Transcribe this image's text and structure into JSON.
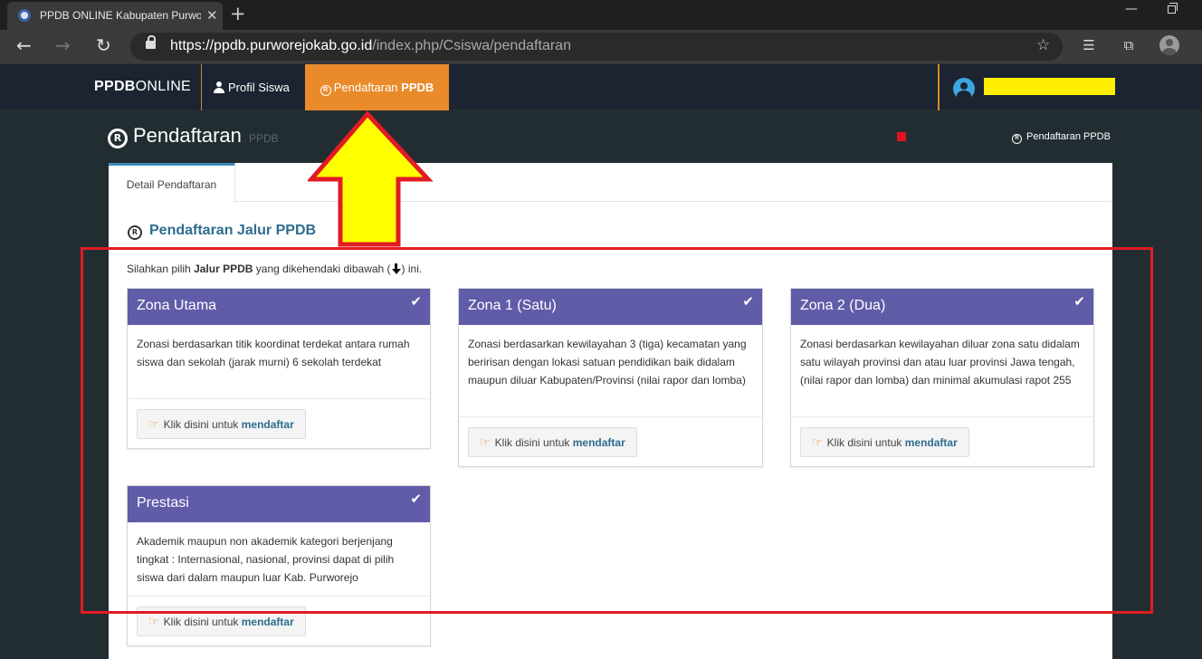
{
  "browser": {
    "tab_title": "PPDB ONLINE Kabupaten Purwo",
    "tab_close": "✕",
    "new_tab": "+",
    "url_host": "https://ppdb.purworejokab.go.id",
    "url_path": "/index.php/Csiswa/pendaftaran"
  },
  "navbar": {
    "brand_bold": "PPDB",
    "brand_light": "ONLINE",
    "items": [
      {
        "label": "Profil Siswa",
        "icon": "user-icon"
      },
      {
        "label_prefix": "Pendaftaran",
        "label_bold": "PPDB",
        "icon": "registered-icon",
        "active": true
      }
    ],
    "accent_color": "#e98b2b"
  },
  "header": {
    "title": "Pendaftaran",
    "subtitle": "PPDB",
    "breadcrumb": "Pendaftaran PPDB"
  },
  "tabs": [
    {
      "label": "Detail Pendaftaran",
      "active": true
    }
  ],
  "section": {
    "title": "Pendaftaran Jalur PPDB",
    "instruction_prefix": "Silahkan pilih",
    "instruction_bold": "Jalur PPDB",
    "instruction_mid": "yang dikehendaki dibawah (",
    "instruction_suffix": ") ini."
  },
  "cards": [
    {
      "title": "Zona Utama",
      "description": "Zonasi berdasarkan titik koordinat terdekat antara rumah siswa dan sekolah (jarak murni) 6 sekolah terdekat",
      "button_prefix": "Klik disini untuk",
      "button_bold": "mendaftar"
    },
    {
      "title": "Zona 1 (Satu)",
      "description": "Zonasi berdasarkan kewilayahan 3 (tiga) kecamatan yang beririsan dengan lokasi satuan pendidikan baik didalam maupun diluar Kabupaten/Provinsi (nilai rapor dan lomba)",
      "button_prefix": "Klik disini untuk",
      "button_bold": "mendaftar"
    },
    {
      "title": "Zona 2 (Dua)",
      "description": "Zonasi berdasarkan kewilayahan diluar zona satu didalam satu wilayah provinsi dan atau luar provinsi Jawa tengah, (nilai rapor dan lomba) dan minimal akumulasi rapot 255",
      "button_prefix": "Klik disini untuk",
      "button_bold": "mendaftar"
    },
    {
      "title": "Prestasi",
      "description": "Akademik maupun non akademik kategori berjenjang tingkat : Internasional, nasional, provinsi dapat di pilih siswa dari dalam maupun luar Kab. Purworejo",
      "button_prefix": "Klik disini untuk",
      "button_bold": "mendaftar"
    }
  ],
  "colors": {
    "card_header": "#605ca8",
    "link_blue": "#2e6d8e",
    "annotation_red": "#e11b24",
    "annotation_yellow": "#ffff00"
  }
}
